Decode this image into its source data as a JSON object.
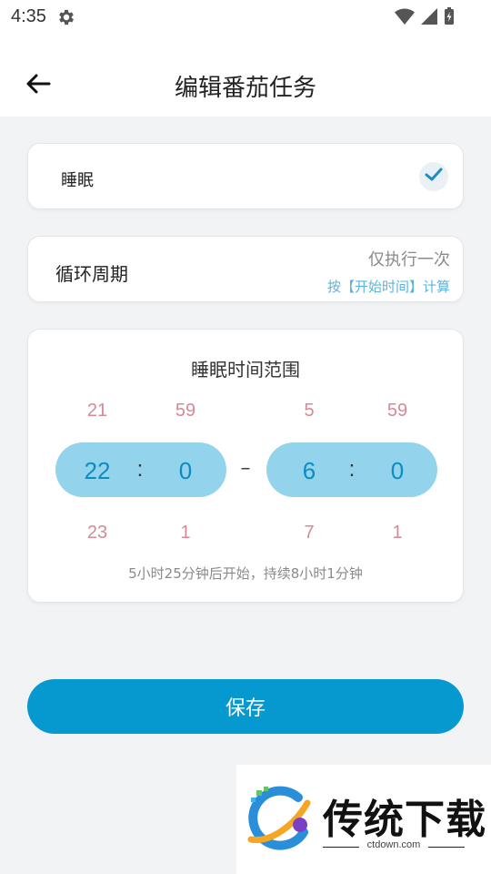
{
  "status_bar": {
    "time": "4:35",
    "icons": [
      "settings-gear-icon",
      "wifi-icon",
      "signal-icon",
      "battery-charging-icon"
    ]
  },
  "header": {
    "back_icon": "arrow-left-icon",
    "title": "编辑番茄任务"
  },
  "task": {
    "name": "睡眠",
    "check_icon": "checkmark-icon",
    "accent": "#1a8fc6"
  },
  "cycle": {
    "label": "循环周期",
    "value": "仅执行一次",
    "note": "按【开始时间】计算"
  },
  "sleep_range": {
    "title": "睡眠时间范围",
    "start": {
      "hour_prev": "21",
      "hour": "22",
      "hour_next": "23",
      "minute_prev": "59",
      "minute": "0",
      "minute_next": "1",
      "separator": ":"
    },
    "dash": "–",
    "end": {
      "hour_prev": "5",
      "hour": "6",
      "hour_next": "7",
      "minute_prev": "59",
      "minute": "0",
      "minute_next": "1",
      "separator": ":"
    },
    "summary": "5小时25分钟后开始，持续8小时1分钟"
  },
  "save_button": {
    "label": "保存",
    "color": "#0699cf"
  },
  "watermark": {
    "brand": "传统下载",
    "site": "ctdown.com"
  }
}
